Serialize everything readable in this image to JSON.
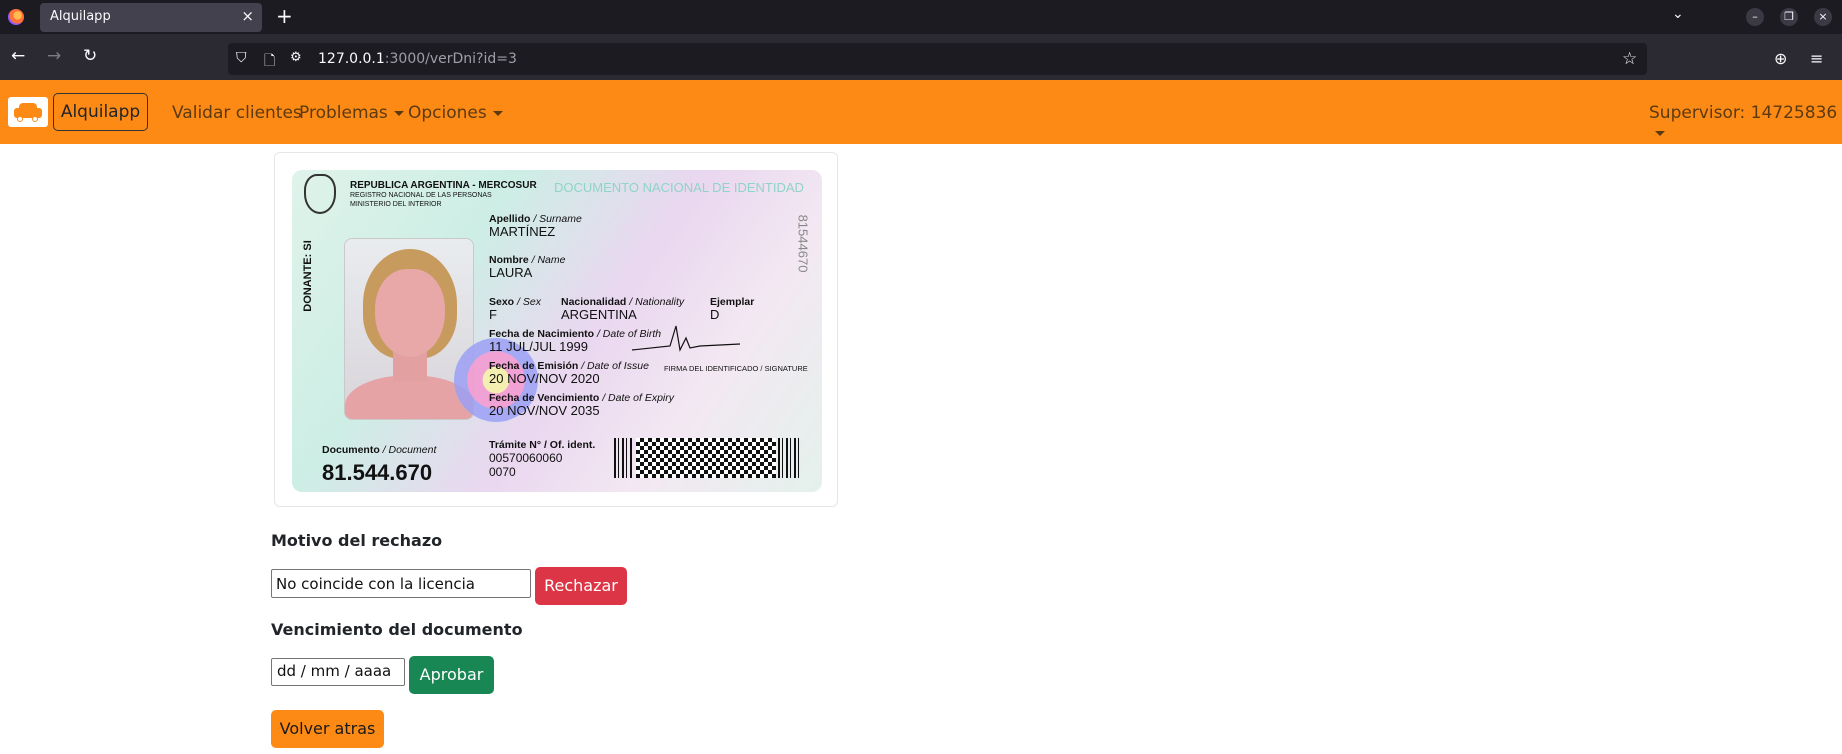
{
  "browser": {
    "tab_title": "Alquilapp",
    "tab_close": "×",
    "new_tab": "+",
    "url_host": "127.0.0.1",
    "url_rest": ":3000/verDni?id=3",
    "icons": {
      "back": "←",
      "forward": "→",
      "reload": "↻",
      "shield": "⛉",
      "page": "🗋",
      "permissions": "⚙",
      "bookmark": "☆",
      "pocket": "⊕",
      "menu": "≡",
      "tabs_list": "⌄",
      "minimize": "–",
      "restore": "❐",
      "close": "×"
    }
  },
  "appbar": {
    "brand": "Alquilapp",
    "nav": [
      "Validar clientes",
      "Problemas",
      "Opciones"
    ],
    "user": "Supervisor: 14725836"
  },
  "dni": {
    "country": "REPUBLICA ARGENTINA -   MERCOSUR",
    "registry": "REGISTRO NACIONAL DE LAS PERSONAS",
    "ministry": "MINISTERIO DEL INTERIOR",
    "doc_title": "DOCUMENTO NACIONAL DE IDENTIDAD",
    "donor": "DONANTE: SI",
    "side_number": "81544670",
    "surname_label": "Apellido",
    "surname_label_en": "/ Surname",
    "surname": "MARTÍNEZ",
    "name_label": "Nombre",
    "name_label_en": "/ Name",
    "name": "LAURA",
    "sex_label": "Sexo",
    "sex_label_en": "/ Sex",
    "sex": "F",
    "nationality_label": "Nacionalidad",
    "nationality_label_en": "/ Nationality",
    "nationality": "ARGENTINA",
    "copy_label": "Ejemplar",
    "copy": "D",
    "birth_label": "Fecha de Nacimiento",
    "birth_label_en": "/ Date of Birth",
    "birth": "11 JUL/JUL 1999",
    "issue_label": "Fecha de Emisión",
    "issue_label_en": "/ Date of Issue",
    "issue": "20 NOV/NOV 2020",
    "expiry_label": "Fecha de Vencimiento",
    "expiry_label_en": "/ Date of Expiry",
    "expiry": "20 NOV/NOV 2035",
    "signature_label": "FIRMA DEL IDENTIFICADO / SIGNATURE",
    "document_label": "Documento",
    "document_label_en": "/ Document",
    "document_number": "81.544.670",
    "tramite_label": "Trámite N° / Of. ident.",
    "tramite": "00570060060",
    "tramite_2": "0070"
  },
  "form": {
    "reject_label": "Motivo del rechazo",
    "reject_value": "No coincide con la licencia",
    "reject_button": "Rechazar",
    "expiry_label": "Vencimiento del documento",
    "expiry_placeholder": "dd / mm / aaaa",
    "approve_button": "Aprobar",
    "back_button": "Volver atras"
  }
}
